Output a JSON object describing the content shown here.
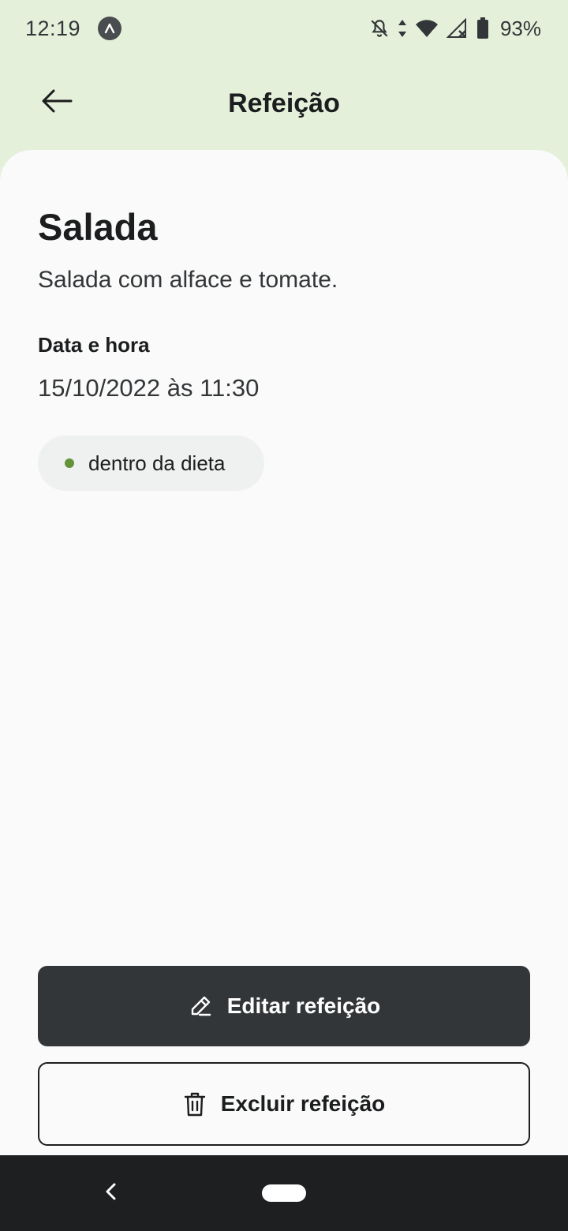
{
  "status_bar": {
    "time": "12:19",
    "app_badge_icon": "expo-logo-icon",
    "icons": [
      "bell-off-icon",
      "data-arrows-icon",
      "wifi-icon",
      "cell-signal-icon",
      "battery-icon"
    ],
    "battery": "93%"
  },
  "header": {
    "back_icon": "arrow-left-icon",
    "title": "Refeição"
  },
  "meal": {
    "name": "Salada",
    "description": "Salada com alface e tomate.",
    "date_label": "Data e hora",
    "date_value": "15/10/2022 às 11:30",
    "diet_status": "dentro da dieta",
    "diet_status_color": "#639339"
  },
  "actions": {
    "edit_label": "Editar refeição",
    "edit_icon": "pencil-icon",
    "delete_label": "Excluir refeição",
    "delete_icon": "trash-icon"
  },
  "navigation": {
    "back_icon": "chevron-left-icon",
    "home_icon": "home-pill-icon"
  },
  "colors": {
    "header_bg": "#E5F0DB",
    "card_bg": "#FAFAFA",
    "primary_button": "#333638",
    "text_dark": "#1B1D1E"
  }
}
